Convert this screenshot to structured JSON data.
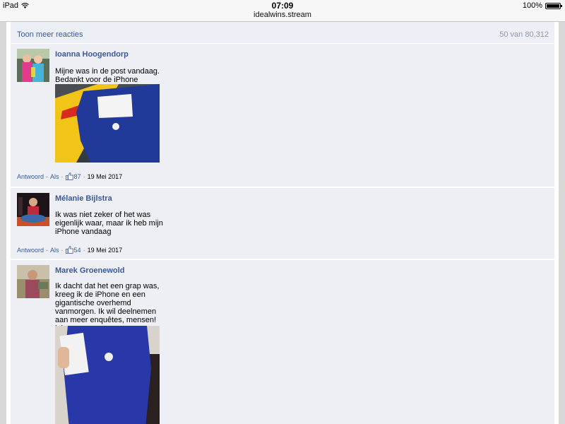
{
  "status": {
    "device": "iPad",
    "time": "07:09",
    "battery": "100%",
    "battery_level": 1.0
  },
  "url": "idealwins.stream",
  "header": {
    "more_link": "Toon meer reacties",
    "count": "50 van 80,312"
  },
  "actions": {
    "reply": "Antwoord",
    "like": "Als"
  },
  "comments": [
    {
      "name": "Ioanna Hoogendorp",
      "text": "Mijne was in de post vandaag. Bedankt voor de iPhone",
      "likes": "87",
      "date": "19 Mei 2017"
    },
    {
      "name": "Mélanie Bijlstra",
      "text": "Ik was niet zeker of het was eigenlijk waar, maar ik heb mijn iPhone vandaag",
      "likes": "54",
      "date": "19 Mei 2017"
    },
    {
      "name": "Marek Groenewold",
      "text": "Ik dacht dat het een grap was, kreeg ik de iPhone en een gigantische overhemd vanmorgen. Ik wil deelnemen aan meer enquêtes, mensen! lol"
    }
  ]
}
